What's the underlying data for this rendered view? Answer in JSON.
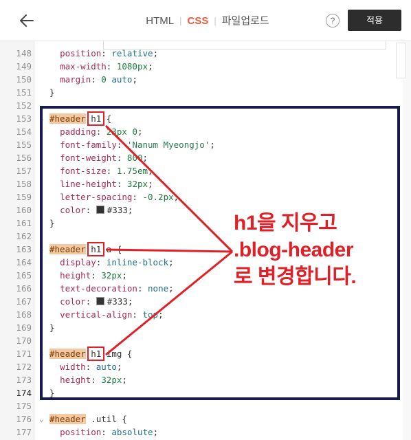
{
  "header": {
    "back_icon": "arrow-left-icon",
    "tabs": [
      {
        "label": "HTML",
        "active": false
      },
      {
        "label": "CSS",
        "active": true
      },
      {
        "label": "파일업로드",
        "active": false
      }
    ],
    "help_label": "?",
    "apply_label": "적용"
  },
  "editor": {
    "current_line": "174",
    "lines": [
      {
        "num": "148",
        "code": "  position: relative;"
      },
      {
        "num": "149",
        "code": "  max-width: 1080px;"
      },
      {
        "num": "150",
        "code": "  margin: 0 auto;"
      },
      {
        "num": "151",
        "code": "}"
      },
      {
        "num": "152",
        "code": ""
      },
      {
        "num": "153",
        "code": "#header h1 {"
      },
      {
        "num": "154",
        "code": "  padding: 23px 0;"
      },
      {
        "num": "155",
        "code": "  font-family: 'Nanum Myeongjo';"
      },
      {
        "num": "156",
        "code": "  font-weight: 800;"
      },
      {
        "num": "157",
        "code": "  font-size: 1.75em;"
      },
      {
        "num": "158",
        "code": "  line-height: 32px;"
      },
      {
        "num": "159",
        "code": "  letter-spacing: -0.2px;"
      },
      {
        "num": "160",
        "code": "  color: #333;"
      },
      {
        "num": "161",
        "code": "}"
      },
      {
        "num": "162",
        "code": ""
      },
      {
        "num": "163",
        "code": "#header h1 a {"
      },
      {
        "num": "164",
        "code": "  display: inline-block;"
      },
      {
        "num": "165",
        "code": "  height: 32px;"
      },
      {
        "num": "166",
        "code": "  text-decoration: none;"
      },
      {
        "num": "167",
        "code": "  color: #333;"
      },
      {
        "num": "168",
        "code": "  vertical-align: top;"
      },
      {
        "num": "169",
        "code": "}"
      },
      {
        "num": "170",
        "code": ""
      },
      {
        "num": "171",
        "code": "#header h1 img {"
      },
      {
        "num": "172",
        "code": "  width: auto;"
      },
      {
        "num": "173",
        "code": "  height: 32px;"
      },
      {
        "num": "174",
        "code": "}"
      },
      {
        "num": "175",
        "code": ""
      },
      {
        "num": "176",
        "code": "#header .util {"
      },
      {
        "num": "177",
        "code": "  position: absolute;"
      }
    ]
  },
  "annotation": {
    "lines": [
      "h1을 지우고",
      ".blog-header",
      "로 변경합니다."
    ],
    "color": "#e21f26",
    "frame_color": "#1a1a4f"
  }
}
